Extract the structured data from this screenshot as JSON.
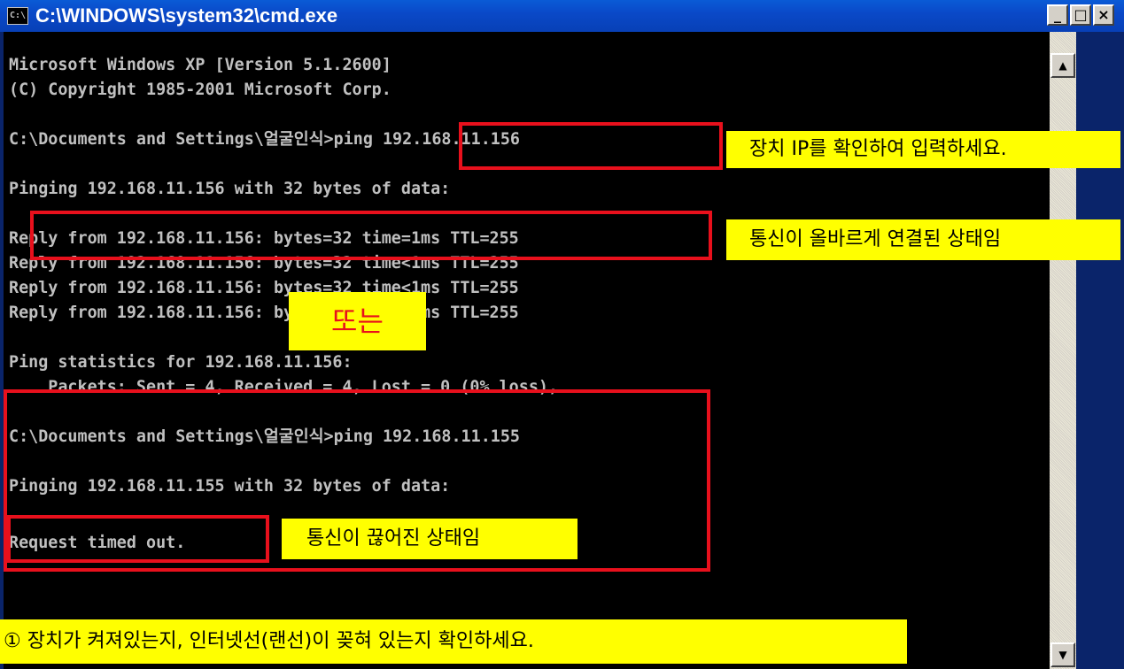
{
  "window": {
    "title": "C:\\WINDOWS\\system32\\cmd.exe",
    "system_icon": "console-icon",
    "buttons": {
      "minimize": "_",
      "maximize": "□",
      "close": "×"
    }
  },
  "console": {
    "lines": [
      "Microsoft Windows XP [Version 5.1.2600]",
      "(C) Copyright 1985-2001 Microsoft Corp.",
      "",
      "C:\\Documents and Settings\\얼굴인식>ping 192.168.11.156",
      "",
      "Pinging 192.168.11.156 with 32 bytes of data:",
      "",
      "Reply from 192.168.11.156: bytes=32 time=1ms TTL=255",
      "Reply from 192.168.11.156: bytes=32 time<1ms TTL=255",
      "Reply from 192.168.11.156: bytes=32 time<1ms TTL=255",
      "Reply from 192.168.11.156: bytes=32 time<1ms TTL=255",
      "",
      "Ping statistics for 192.168.11.156:",
      "    Packets: Sent = 4, Received = 4, Lost = 0 (0% loss),",
      "",
      "C:\\Documents and Settings\\얼굴인식>ping 192.168.11.155",
      "",
      "Pinging 192.168.11.155 with 32 bytes of data:",
      "",
      "Request timed out."
    ]
  },
  "annotations": {
    "check_ip": "장치 IP를 확인하여 입력하세요.",
    "connected": "통신이 올바르게 연결된 상태임",
    "or": "또는",
    "disconnected": "통신이 끊어진 상태임",
    "tip": "① 장치가 켜져있는지, 인터넷선(랜선)이 꽂혀 있는지 확인하세요."
  },
  "colors": {
    "highlight_box": "#e8101c",
    "callout_bg": "#ffff00",
    "titlebar": "#0a49c8",
    "console_bg": "#000000",
    "console_text": "#c0c0c0"
  }
}
